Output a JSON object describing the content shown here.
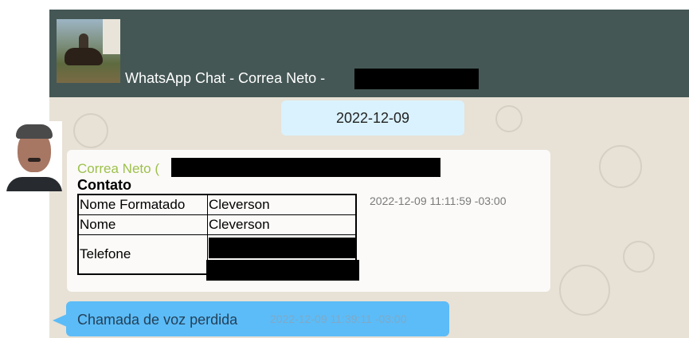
{
  "header": {
    "title": "WhatsApp Chat - Correa Neto -"
  },
  "chat": {
    "date_badge": "2022-12-09",
    "contact_message": {
      "sender": "Correa Neto (",
      "title": "Contato",
      "rows": [
        {
          "key": "Nome Formatado",
          "value": "Cleverson"
        },
        {
          "key": "Nome",
          "value": "Cleverson"
        },
        {
          "key": "Telefone",
          "value": ""
        }
      ],
      "timestamp": "2022-12-09 11:11:59 -03:00"
    },
    "missed_call": {
      "text": "Chamada de voz perdida",
      "timestamp": "2022-12-09 11:39:11 -03:00"
    }
  },
  "colors": {
    "header_bg": "#445755",
    "chat_bg": "#e8e1d6",
    "date_badge_bg": "#daf2fd",
    "sender_name": "#9ec04c",
    "missed_call_bg": "#5cbcf7"
  }
}
